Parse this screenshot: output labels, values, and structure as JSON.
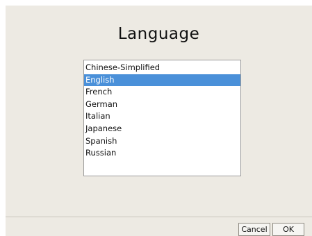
{
  "dialog": {
    "title": "Language"
  },
  "languages": {
    "items": [
      {
        "label": "Chinese-Simplified",
        "selected": false
      },
      {
        "label": "English",
        "selected": true
      },
      {
        "label": "French",
        "selected": false
      },
      {
        "label": "German",
        "selected": false
      },
      {
        "label": "Italian",
        "selected": false
      },
      {
        "label": "Japanese",
        "selected": false
      },
      {
        "label": "Spanish",
        "selected": false
      },
      {
        "label": "Russian",
        "selected": false
      }
    ],
    "selected_color": "#4a90d9"
  },
  "buttons": {
    "cancel_label": "Cancel",
    "ok_label": "OK"
  }
}
